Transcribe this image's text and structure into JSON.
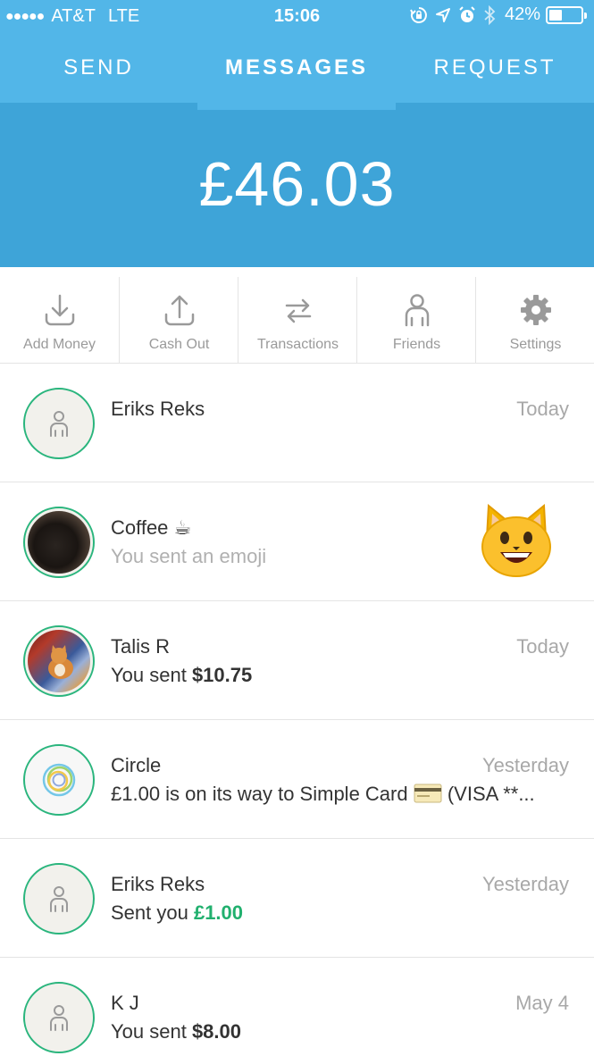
{
  "status_bar": {
    "signal_dots": "●●●●●",
    "carrier": "AT&T",
    "network": "LTE",
    "time": "15:06",
    "battery_percent": "42%",
    "icons": [
      "lock-rotation-icon",
      "location-icon",
      "alarm-icon",
      "bluetooth-icon",
      "battery-icon"
    ]
  },
  "tabs": {
    "send": "SEND",
    "messages": "MESSAGES",
    "request": "REQUEST",
    "active": "messages"
  },
  "balance": "£46.03",
  "actions": [
    {
      "label": "Add Money",
      "icon": "download-icon"
    },
    {
      "label": "Cash Out",
      "icon": "upload-icon"
    },
    {
      "label": "Transactions",
      "icon": "swap-arrows-icon"
    },
    {
      "label": "Friends",
      "icon": "person-icon"
    },
    {
      "label": "Settings",
      "icon": "gear-icon"
    }
  ],
  "messages": [
    {
      "name": "Eriks Reks",
      "subtitle": "",
      "date": "Today",
      "avatar": "placeholder-person"
    },
    {
      "name": "Coffee ☕",
      "subtitle": "You sent an emoji",
      "date": "",
      "avatar": "photo-coffee",
      "attachment": "smiling-cat-emoji"
    },
    {
      "name": "Talis R",
      "subtitle_prefix": "You sent ",
      "subtitle_amount": "$10.75",
      "date": "Today",
      "avatar": "photo-cat"
    },
    {
      "name": "Circle",
      "subtitle_prefix": "£1.00 is on its way to Simple Card ",
      "subtitle_suffix": " (VISA **...",
      "date": "Yesterday",
      "avatar": "circle-logo",
      "inline_icon": "credit-card-icon"
    },
    {
      "name": "Eriks Reks",
      "subtitle_prefix": "Sent you ",
      "subtitle_amount": "£1.00",
      "date": "Yesterday",
      "avatar": "placeholder-person"
    },
    {
      "name": "K J",
      "subtitle_prefix": "You sent ",
      "subtitle_amount": "$8.00",
      "date": "May 4",
      "avatar": "placeholder-person"
    }
  ],
  "colors": {
    "header": "#52b6e8",
    "balance_bg": "#3ea4d8",
    "accent_green": "#21b06e",
    "avatar_ring": "#2ab57d"
  }
}
